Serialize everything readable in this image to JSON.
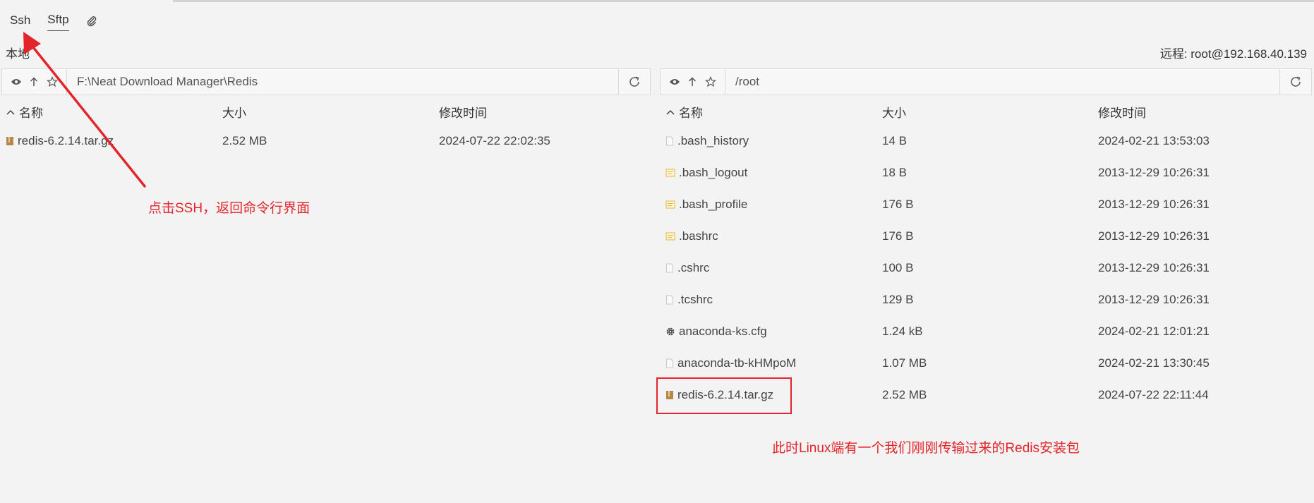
{
  "tabs": [
    {
      "label": "Ssh"
    },
    {
      "label": "Sftp"
    }
  ],
  "local": {
    "label": "本地",
    "path": "F:\\Neat Download Manager\\Redis",
    "headers": {
      "name": "名称",
      "size": "大小",
      "mtime": "修改时间"
    },
    "files": [
      {
        "name": "redis-6.2.14.tar.gz",
        "size": "2.52 MB",
        "mtime": "2024-07-22 22:02:35",
        "icon": "archive-icon"
      }
    ]
  },
  "remote": {
    "label": "远程: root@192.168.40.139",
    "path": "/root",
    "headers": {
      "name": "名称",
      "size": "大小",
      "mtime": "修改时间"
    },
    "files": [
      {
        "name": ".bash_history",
        "size": "14 B",
        "mtime": "2024-02-21 13:53:03",
        "icon": "file-icon"
      },
      {
        "name": ".bash_logout",
        "size": "18 B",
        "mtime": "2013-12-29 10:26:31",
        "icon": "script-file-icon"
      },
      {
        "name": ".bash_profile",
        "size": "176 B",
        "mtime": "2013-12-29 10:26:31",
        "icon": "script-file-icon"
      },
      {
        "name": ".bashrc",
        "size": "176 B",
        "mtime": "2013-12-29 10:26:31",
        "icon": "script-file-icon"
      },
      {
        "name": ".cshrc",
        "size": "100 B",
        "mtime": "2013-12-29 10:26:31",
        "icon": "file-icon"
      },
      {
        "name": ".tcshrc",
        "size": "129 B",
        "mtime": "2013-12-29 10:26:31",
        "icon": "file-icon"
      },
      {
        "name": "anaconda-ks.cfg",
        "size": "1.24 kB",
        "mtime": "2024-02-21 12:01:21",
        "icon": "gear-icon"
      },
      {
        "name": "anaconda-tb-kHMpoM",
        "size": "1.07 MB",
        "mtime": "2024-02-21 13:30:45",
        "icon": "file-icon"
      },
      {
        "name": "redis-6.2.14.tar.gz",
        "size": "2.52 MB",
        "mtime": "2024-07-22 22:11:44",
        "icon": "archive-icon"
      }
    ]
  },
  "annotations": {
    "ssh_hint": "点击SSH，返回命令行界面",
    "linux_hint": "此时Linux端有一个我们刚刚传输过来的Redis安装包"
  },
  "colors": {
    "annotation": "#e3242b",
    "folder": "#e8b53a",
    "archive": "#b5874a"
  }
}
